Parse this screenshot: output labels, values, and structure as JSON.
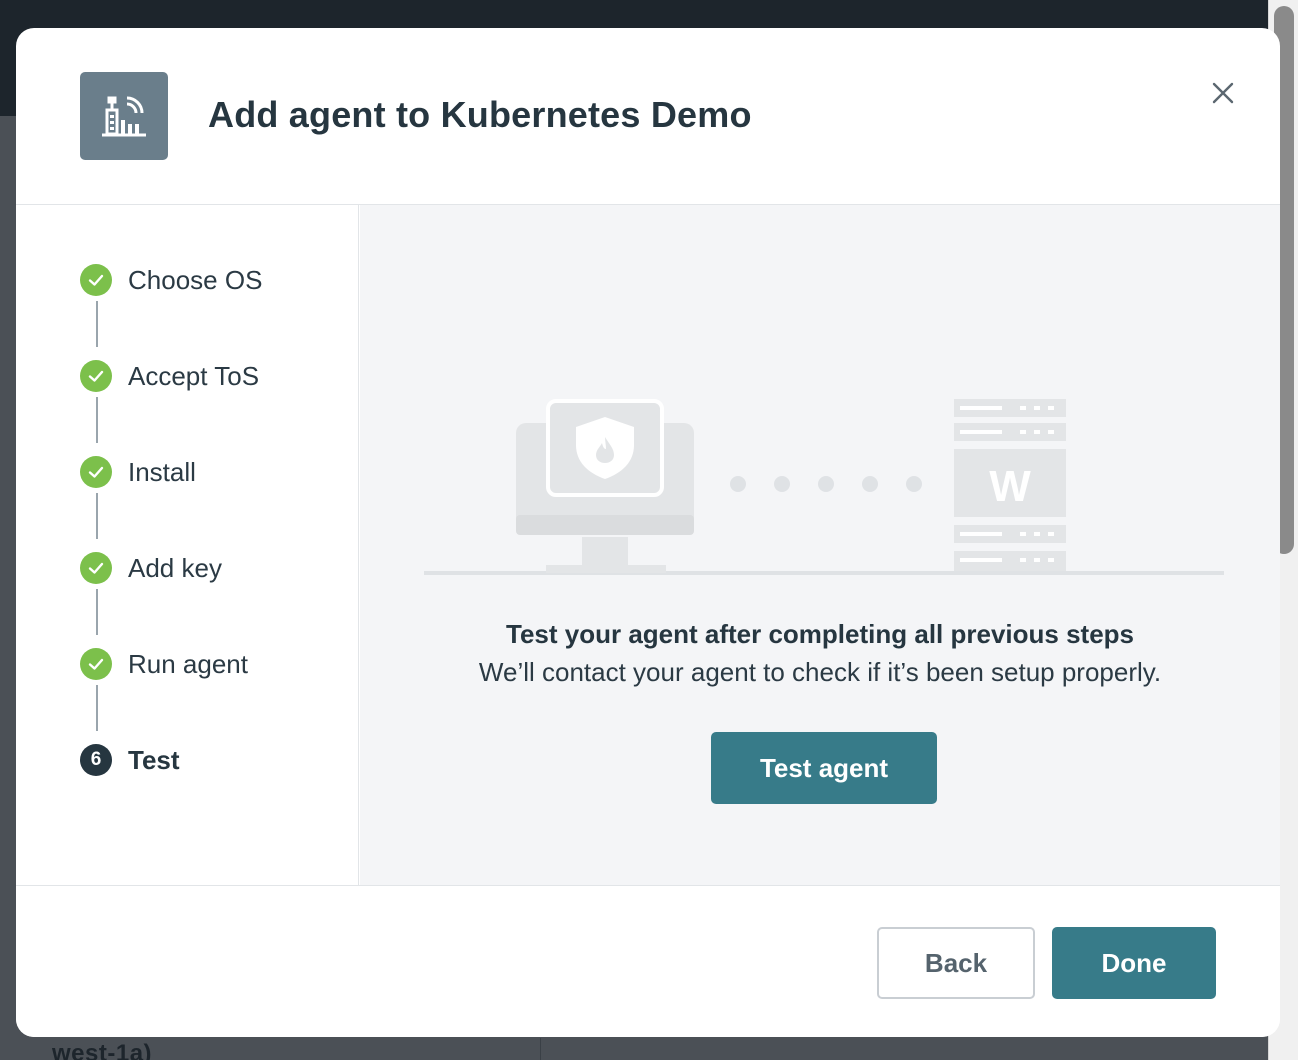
{
  "background": {
    "fragment_text": "west-1a)"
  },
  "modal": {
    "title": "Add agent to Kubernetes Demo",
    "header_icon": "agent-building-icon",
    "close_icon": "close-icon"
  },
  "steps": [
    {
      "label": "Choose OS",
      "status": "completed",
      "icon": "check-icon"
    },
    {
      "label": "Accept ToS",
      "status": "completed",
      "icon": "check-icon"
    },
    {
      "label": "Install",
      "status": "completed",
      "icon": "check-icon"
    },
    {
      "label": "Add key",
      "status": "completed",
      "icon": "check-icon"
    },
    {
      "label": "Run agent",
      "status": "completed",
      "icon": "check-icon"
    },
    {
      "label": "Test",
      "status": "current",
      "number": "6"
    }
  ],
  "content": {
    "server_letter": "W",
    "heading": "Test your agent after completing all previous steps",
    "subtext": "We’ll contact your agent to check if it’s been setup properly.",
    "test_button_label": "Test agent"
  },
  "footer": {
    "back_label": "Back",
    "done_label": "Done"
  },
  "colors": {
    "accent": "#377b89",
    "success": "#7cc04b",
    "current_step": "#263640"
  }
}
